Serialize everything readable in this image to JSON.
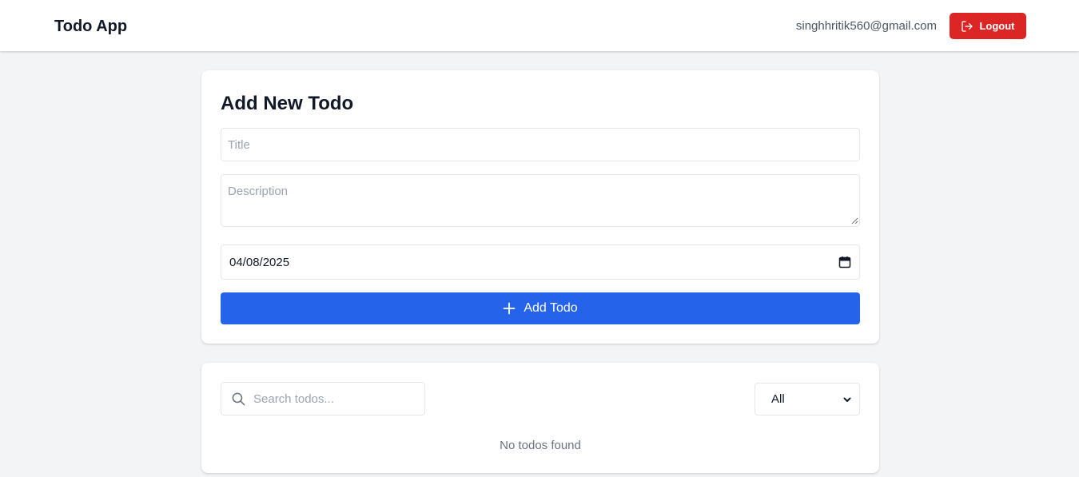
{
  "navbar": {
    "brand": "Todo App",
    "user_email": "singhhritik560@gmail.com",
    "logout_label": "Logout",
    "logout_color": "#dc2626"
  },
  "add_form": {
    "heading": "Add New Todo",
    "title_placeholder": "Title",
    "description_placeholder": "Description",
    "date_value": "04/08/2025",
    "submit_label": "Add Todo",
    "submit_color": "#2563eb"
  },
  "list": {
    "search_placeholder": "Search todos...",
    "filter_selected": "All",
    "empty_message": "No todos found"
  },
  "icons": {
    "logout": "logout-icon",
    "calendar": "calendar-icon",
    "plus": "plus-icon",
    "search": "search-icon",
    "chevron": "chevron-down-icon"
  }
}
